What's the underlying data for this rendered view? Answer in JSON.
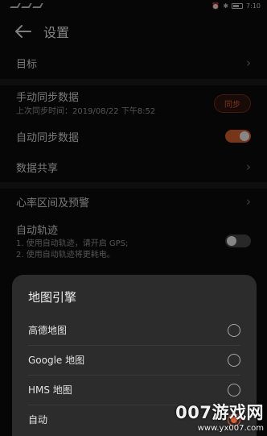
{
  "status_bar": {
    "left_text": "ᵢ ᵢ ᵢ",
    "time": "7:10"
  },
  "header": {
    "title": "设置"
  },
  "settings": {
    "goal": "目标",
    "manual_sync": "手动同步数据",
    "last_sync": "上次同步时间：2019/08/22 下午8:52",
    "sync_button": "同步",
    "auto_sync": "自动同步数据",
    "auto_sync_on": true,
    "data_share": "数据共享",
    "heart_rate": "心率区间及预警",
    "auto_track": "自动轨迹",
    "auto_track_desc_1": "1. 使用自动轨迹，请开启 GPS;",
    "auto_track_desc_2": "2. 使用自动轨迹将更耗电。",
    "auto_track_on": false
  },
  "dialog": {
    "title": "地图引擎",
    "options": [
      {
        "label": "高德地图",
        "selected": false
      },
      {
        "label": "Google 地图",
        "selected": false
      },
      {
        "label": "HMS 地图",
        "selected": false
      },
      {
        "label": "自动",
        "selected": true
      }
    ]
  },
  "watermark": {
    "logo": "007游戏网",
    "url": "www.yx007.com"
  },
  "colors": {
    "accent": "#e2603a",
    "background": "#0b0b0b",
    "dialog": "#2c2c2c"
  }
}
